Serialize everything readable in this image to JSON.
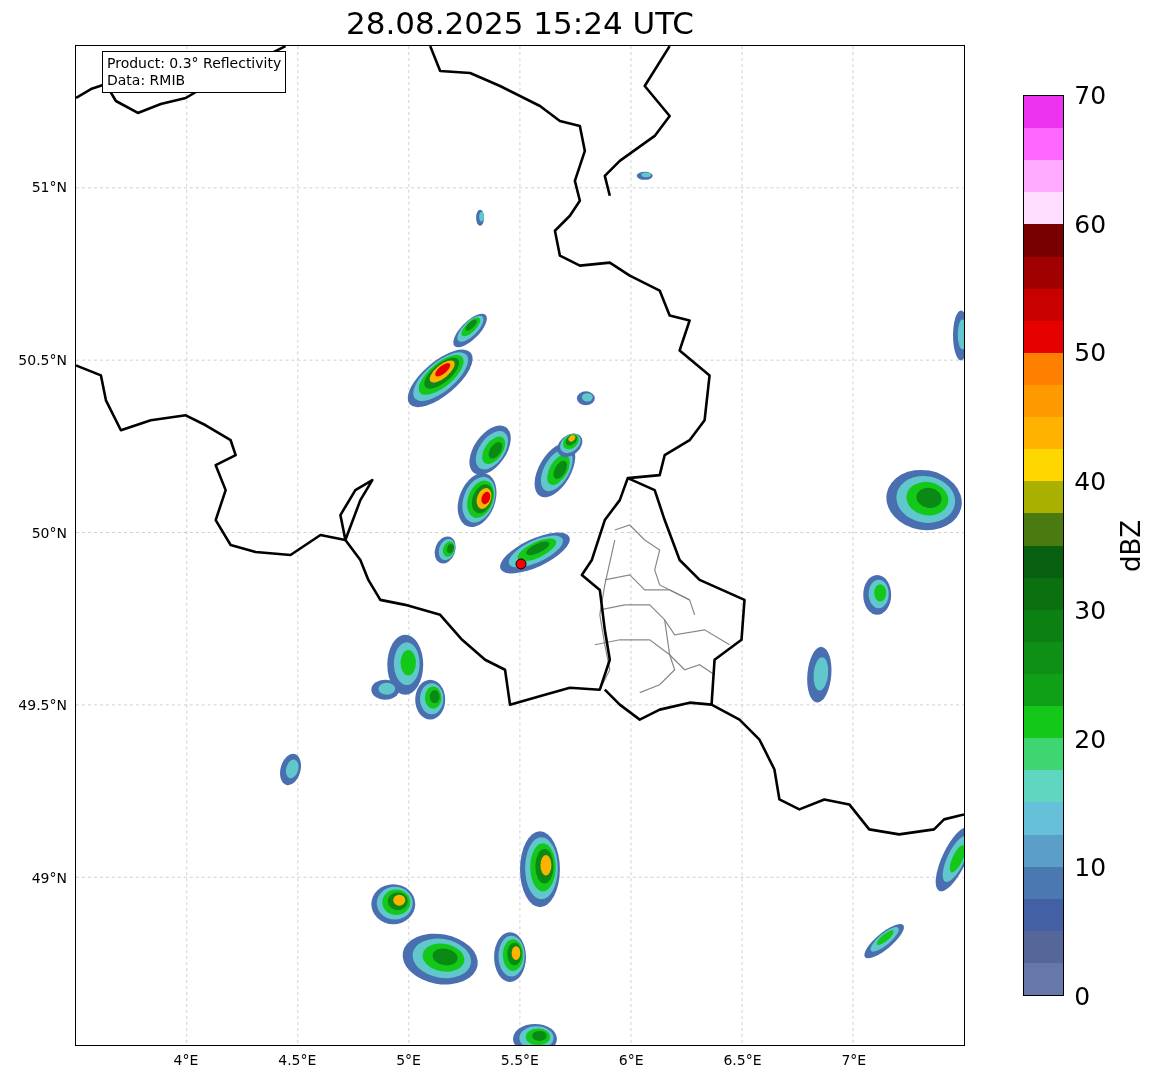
{
  "title": "28.08.2025 15:24 UTC",
  "info_box": {
    "lines": [
      "Product: 0.3° Reflectivity",
      "Data: RMIB"
    ]
  },
  "y_ticks": [
    {
      "label": "51°N"
    },
    {
      "label": "50.5°N"
    },
    {
      "label": "50°N"
    },
    {
      "label": "49.5°N"
    },
    {
      "label": "49°N"
    }
  ],
  "x_ticks": [
    {
      "label": "4°E"
    },
    {
      "label": "4.5°E"
    },
    {
      "label": "5°E"
    },
    {
      "label": "5.5°E"
    },
    {
      "label": "6°E"
    },
    {
      "label": "6.5°E"
    },
    {
      "label": "7°E"
    }
  ],
  "colorbar": {
    "label": "dBZ",
    "ticks": [
      "70",
      "60",
      "50",
      "40",
      "30",
      "20",
      "10",
      "0"
    ],
    "segments": [
      {
        "color": "#ee33ee"
      },
      {
        "color": "#ff66ff"
      },
      {
        "color": "#ffaaff"
      },
      {
        "color": "#ffddff"
      },
      {
        "color": "#780000"
      },
      {
        "color": "#a00000"
      },
      {
        "color": "#c80000"
      },
      {
        "color": "#e60000"
      },
      {
        "color": "#ff7f00"
      },
      {
        "color": "#ff9900"
      },
      {
        "color": "#ffb300"
      },
      {
        "color": "#ffd700"
      },
      {
        "color": "#aab000"
      },
      {
        "color": "#4a7a10"
      },
      {
        "color": "#066010"
      },
      {
        "color": "#0a7010"
      },
      {
        "color": "#0c8012"
      },
      {
        "color": "#0e9016"
      },
      {
        "color": "#10a018"
      },
      {
        "color": "#14c81a"
      },
      {
        "color": "#3dd670"
      },
      {
        "color": "#5fd6c0"
      },
      {
        "color": "#66c0d8"
      },
      {
        "color": "#5b9ec8"
      },
      {
        "color": "#4a78b0"
      },
      {
        "color": "#4460a5"
      },
      {
        "color": "#556699"
      },
      {
        "color": "#6677aa"
      }
    ]
  }
}
